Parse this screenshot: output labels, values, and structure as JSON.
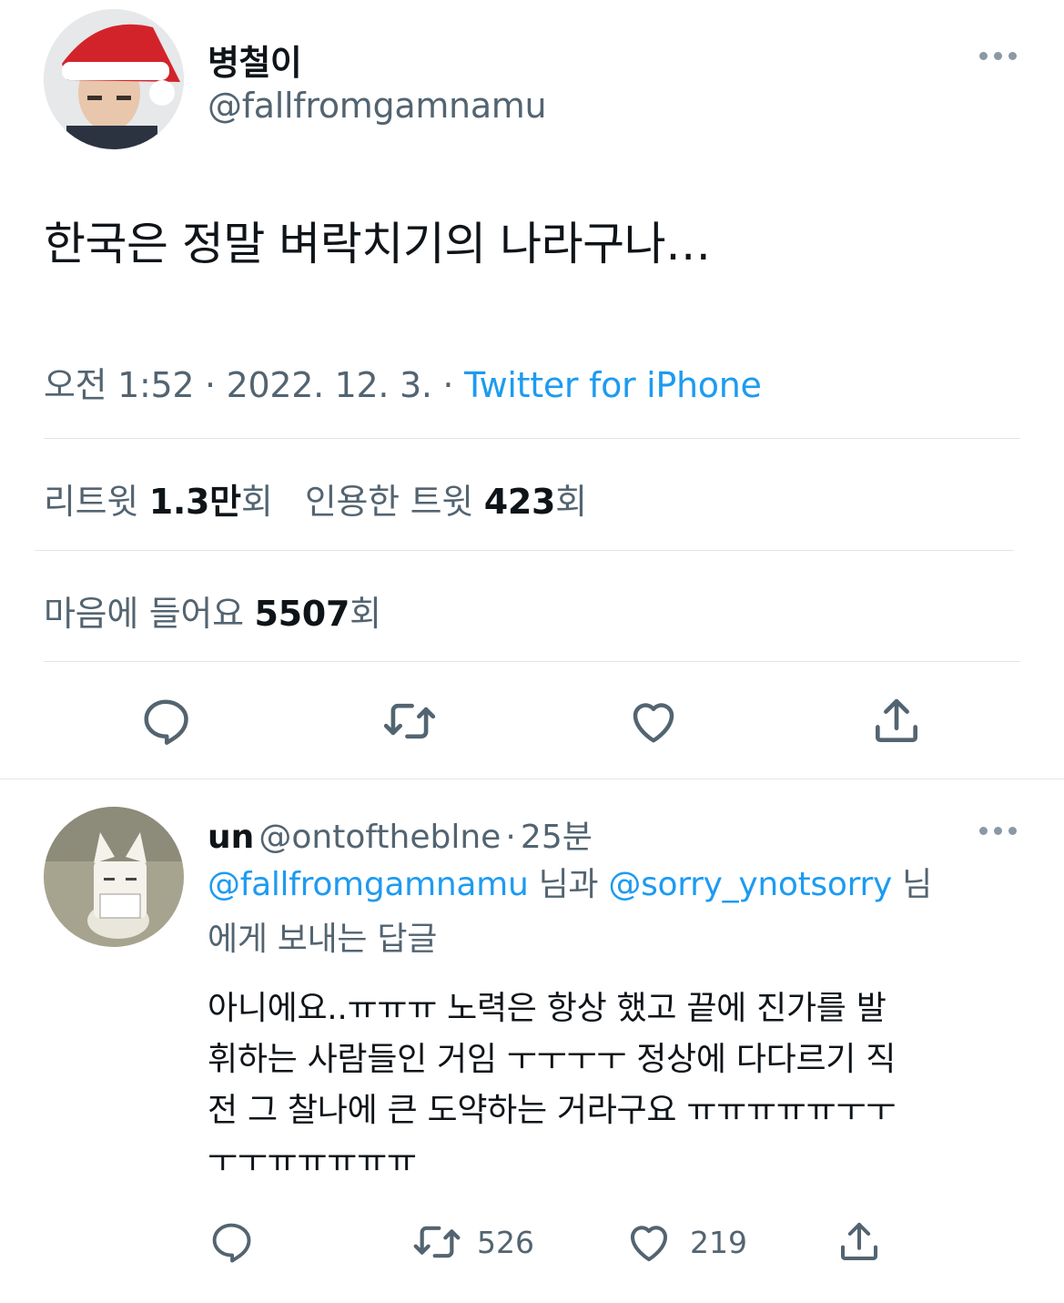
{
  "tweet": {
    "display_name": "병철이",
    "handle": "@fallfromgamnamu",
    "text": "한국은 정말 벼락치기의 나라구나…",
    "time": "오전 1:52",
    "date": "2022. 12. 3.",
    "separator": "·",
    "source": "Twitter for iPhone",
    "stats": {
      "retweets_label": "리트윗",
      "retweets_value": "1.3만",
      "retweets_unit": "회",
      "quotes_label": "인용한 트윗",
      "quotes_value": "423",
      "quotes_unit": "회",
      "likes_label": "마음에 들어요",
      "likes_value": "5507",
      "likes_unit": "회"
    },
    "actions": [
      "reply-icon",
      "retweet-icon",
      "like-icon",
      "share-icon"
    ]
  },
  "reply": {
    "display_name": "un",
    "handle": "@ontoftheblne",
    "separator": "·",
    "time_ago": "25분",
    "replying": {
      "mention1": "@fallfromgamnamu",
      "conj": " 님과 ",
      "mention2": "@sorry_ynotsorry",
      "tail1": " 님",
      "tail2": "에게 보내는 답글"
    },
    "text_lines": [
      "아니에요..ㅠㅠㅠ 노력은 항상 했고 끝에 진가를 발",
      "휘하는 사람들인 거임 ㅜㅜㅜㅜ 정상에 다다르기 직",
      "전 그 찰나에 큰 도약하는 거라구요 ㅠㅠㅠㅠㅠㅜㅜ",
      "ㅜㅜㅠㅠㅠㅠㅠ"
    ],
    "retweet_count": "526",
    "like_count": "219"
  },
  "colors": {
    "accent": "#1d9bf0",
    "secondary_text": "#536471",
    "divider": "#e1e6ea",
    "icon": "#536471"
  }
}
